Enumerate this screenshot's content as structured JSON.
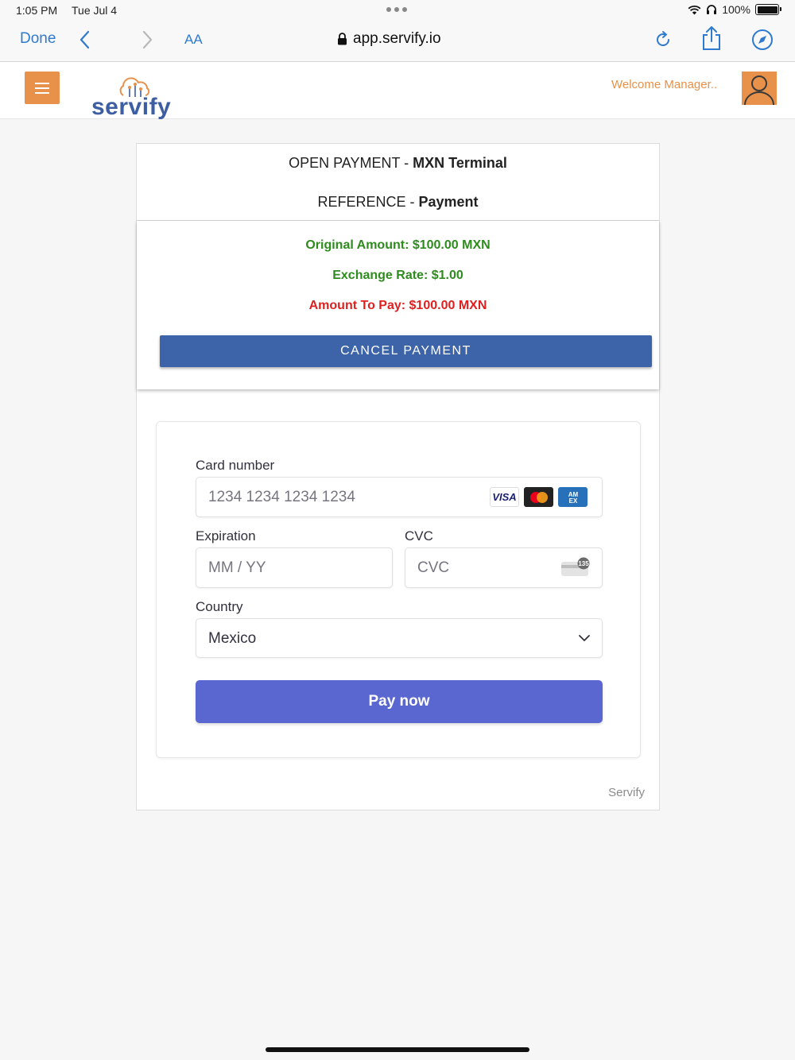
{
  "status_bar": {
    "time": "1:05 PM",
    "date": "Tue Jul 4",
    "battery": "100%"
  },
  "browser": {
    "done_label": "Done",
    "text_size_label": "AA",
    "url": "app.servify.io"
  },
  "app_header": {
    "logo_text": "servify",
    "welcome": "Welcome Manager..",
    "colors": {
      "accent": "#e8914a",
      "brand_blue": "#3d5ea2"
    }
  },
  "payment": {
    "title_prefix": "OPEN PAYMENT -",
    "title_bold": "MXN Terminal",
    "reference_prefix": "REFERENCE -",
    "reference_bold": "Payment",
    "original_amount": "Original Amount: $100.00 MXN",
    "exchange_rate": "Exchange Rate: $1.00",
    "amount_to_pay": "Amount To Pay: $100.00 MXN",
    "cancel_label": "CANCEL PAYMENT"
  },
  "card_form": {
    "card_number_label": "Card number",
    "card_number_placeholder": "1234 1234 1234 1234",
    "brands": [
      "VISA",
      "mastercard",
      "AM EX"
    ],
    "expiration_label": "Expiration",
    "expiration_placeholder": "MM / YY",
    "cvc_label": "CVC",
    "cvc_placeholder": "CVC",
    "cvc_badge": "135",
    "country_label": "Country",
    "country_value": "Mexico",
    "pay_label": "Pay now"
  },
  "footer": {
    "brand": "Servify"
  }
}
